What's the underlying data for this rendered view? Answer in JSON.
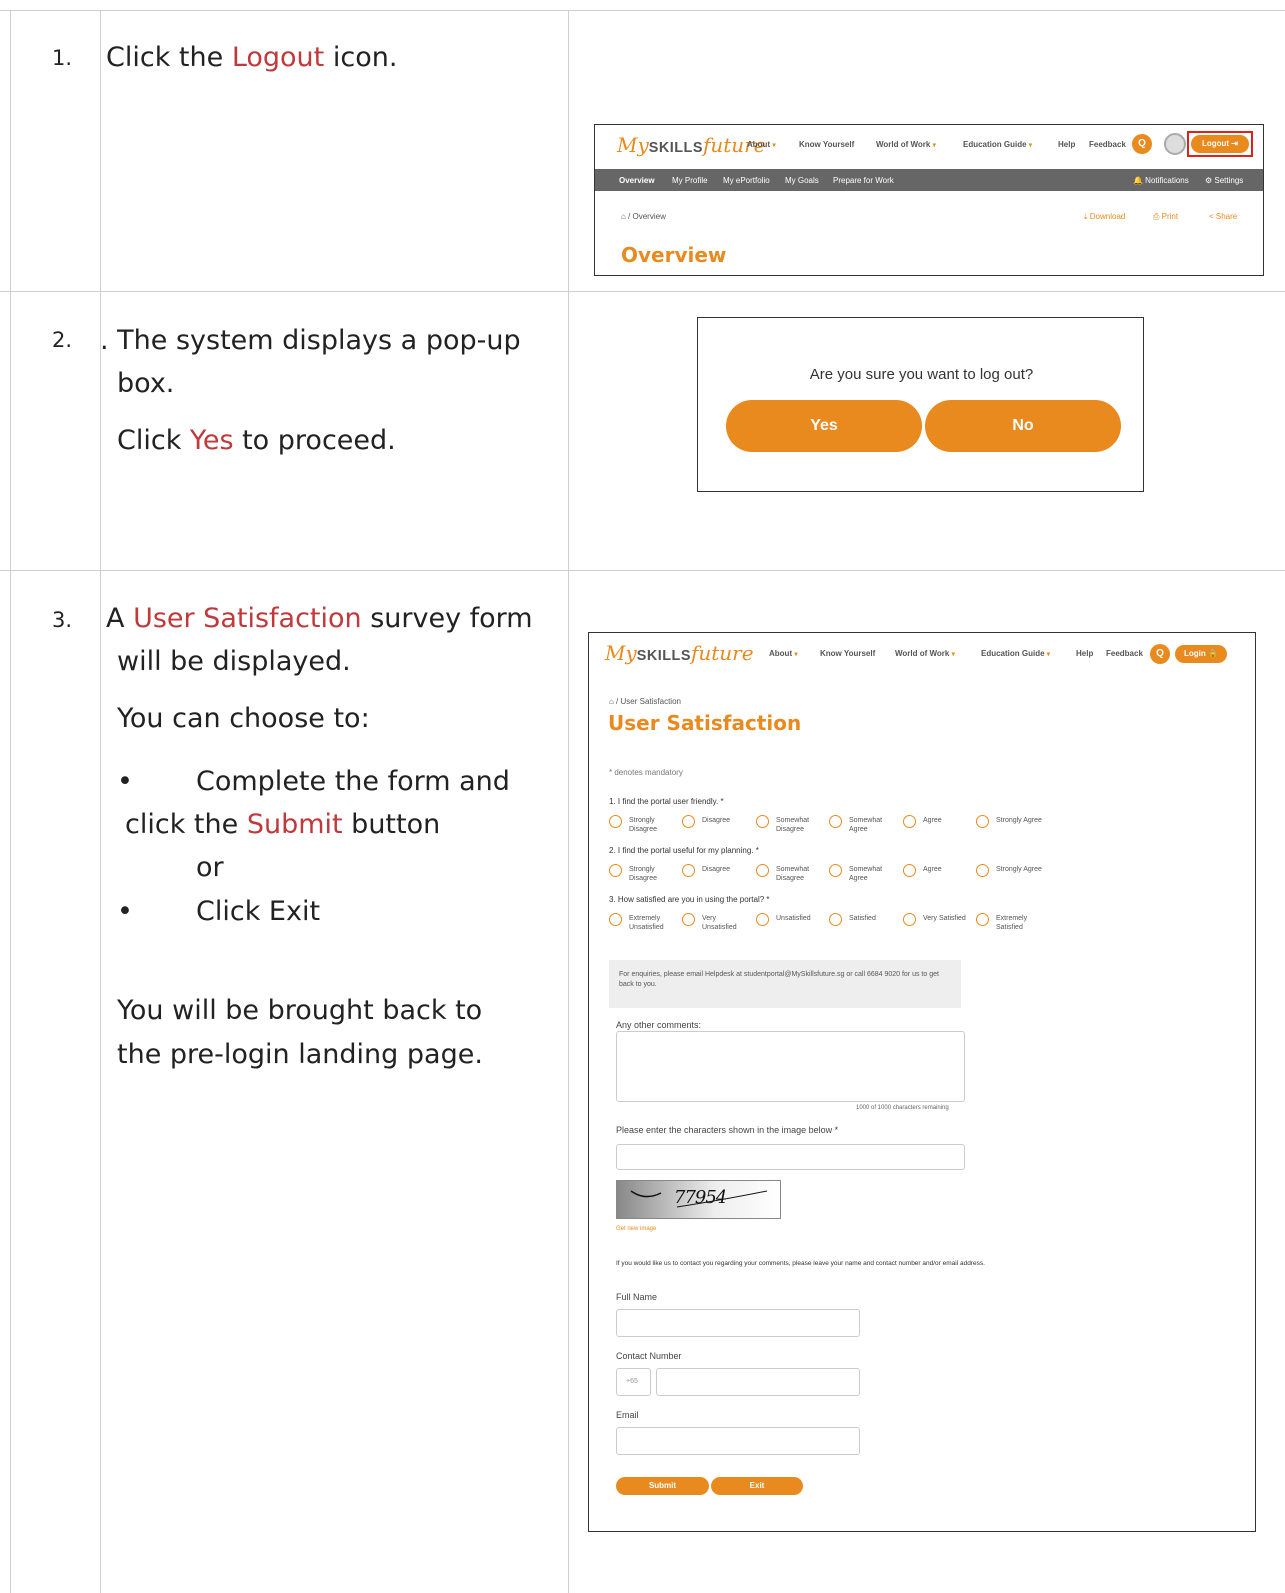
{
  "steps": [
    {
      "number": "1.",
      "text_before": "Click the ",
      "highlight": "Logout",
      "text_after": " icon."
    },
    {
      "number": "2.",
      "line1_prefix": ". ",
      "line1": "The system displays a pop-up",
      "line2": "box.",
      "line3_before": "Click ",
      "line3_highlight": "Yes",
      "line3_after": " to proceed."
    },
    {
      "number": "3.",
      "line1_before": "A ",
      "line1_highlight": "User Satisfaction",
      "line1_after": " survey form",
      "line2": "will be displayed.",
      "line3": "You can choose to:",
      "bullet1_a": "Complete the form and",
      "bullet1_b_before": "click the ",
      "bullet1_b_highlight": "Submit",
      "bullet1_b_after": " button",
      "or": "or",
      "bullet2": "Click Exit",
      "bullet_glyph": "•",
      "line4": "You will be brought back to",
      "line5": "the pre-login landing page."
    }
  ],
  "shot1": {
    "logo_my": "My",
    "logo_skills": "SKILLS",
    "logo_future": "future",
    "nav": [
      "About",
      "Know Yourself",
      "World of Work",
      "Education Guide",
      "Help",
      "Feedback"
    ],
    "caret": "▾",
    "search_glyph": "Q",
    "logout": "Logout ⇥",
    "subnav": [
      "Overview",
      "My Profile",
      "My ePortfolio",
      "My Goals",
      "Prepare for Work"
    ],
    "notifications": "🔔 Notifications",
    "settings": "⚙ Settings",
    "breadcrumb": "⌂ / Overview",
    "download": "⤓ Download",
    "print": "⎙ Print",
    "share": "< Share",
    "title": "Overview"
  },
  "shot2": {
    "question": "Are you sure you want to log out?",
    "yes": "Yes",
    "no": "No"
  },
  "shot3": {
    "nav": [
      "About",
      "Know Yourself",
      "World of Work",
      "Education Guide",
      "Help",
      "Feedback"
    ],
    "login": "Login 🔒",
    "breadcrumb": "⌂ / User Satisfaction",
    "title": "User Satisfaction",
    "mandatory": "* denotes mandatory",
    "q1": "1. I find the portal user friendly. *",
    "q2": "2. I find the portal useful for my planning. *",
    "q3": "3. How satisfied are you in using the portal? *",
    "agree_opts": [
      "Strongly Disagree",
      "Disagree",
      "Somewhat Disagree",
      "Somewhat Agree",
      "Agree",
      "Strongly Agree"
    ],
    "sat_opts": [
      "Extremely Unsatisfied",
      "Very Unsatisfied",
      "Unsatisfied",
      "Satisfied",
      "Very Satisfied",
      "Extremely Satisfied"
    ],
    "enquiry": "For enquiries, please email Helpdesk at studentportal@MySkillsfuture.sg or call 6684 9020 for us to get back to you.",
    "comments_label": "Any other comments:",
    "chars_remaining": "1000 of 1000 characters remaining",
    "captcha_label": "Please enter the characters shown in the image below *",
    "captcha_text": "77954",
    "new_image": "Get new image",
    "contact_note": "If you would like us to contact you regarding your comments, please leave your name and contact number and/or email address.",
    "full_name": "Full Name",
    "contact_number": "Contact Number",
    "country_code": "+65",
    "email": "Email",
    "submit": "Submit",
    "exit": "Exit"
  }
}
